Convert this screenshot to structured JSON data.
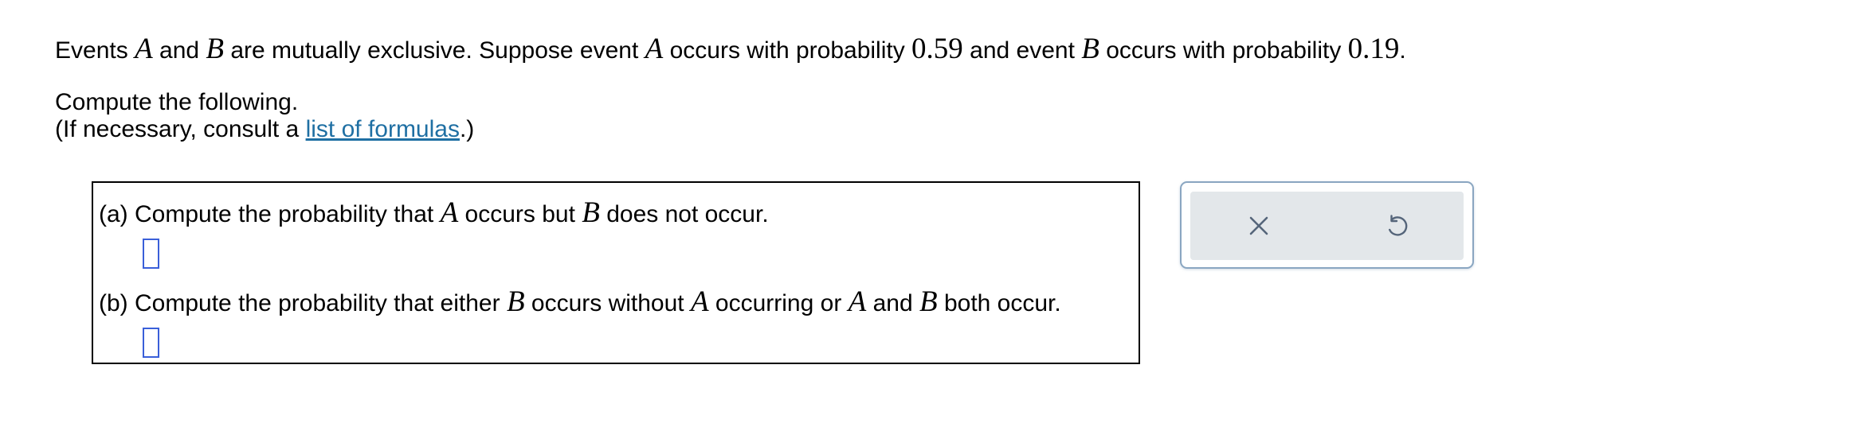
{
  "intro": {
    "t1": "Events ",
    "varA": "A",
    "t2": " and ",
    "varB": "B",
    "t3": " are mutually exclusive. Suppose event ",
    "varA2": "A",
    "t4": " occurs with probability ",
    "probA": "0.59",
    "t5": " and event ",
    "varB2": "B",
    "t6": " occurs with probability ",
    "probB": "0.19",
    "t7": "."
  },
  "compute_line": "Compute the following.",
  "consult": {
    "prefix": "(If necessary, consult a ",
    "link": "list of formulas",
    "suffix": ".)"
  },
  "question_a": {
    "t1": "(a) Compute the probability that ",
    "varA": "A",
    "t2": " occurs but ",
    "varB": "B",
    "t3": " does not occur.",
    "answer": ""
  },
  "question_b": {
    "t1": "(b) Compute the probability that either ",
    "varB": "B",
    "t2": " occurs without ",
    "varA": "A",
    "t3": " occurring or ",
    "varA2": "A",
    "t4": " and ",
    "varB2": "B",
    "t5": " both occur.",
    "answer": ""
  },
  "tools": {
    "clear_icon": "x-icon",
    "undo_icon": "undo-icon",
    "icon_color": "#55657a"
  },
  "colors": {
    "link": "#1f6fa3",
    "input_border": "#3a5fd9",
    "panel_border": "#8aa6c1",
    "panel_fill": "#e3e7ea"
  }
}
